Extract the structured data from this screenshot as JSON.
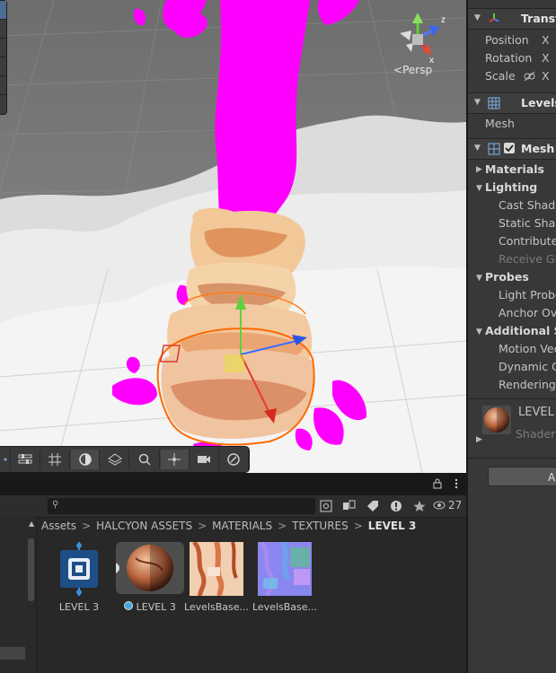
{
  "scene": {
    "camera_label": "Persp",
    "gizmo_axes": {
      "x": "x",
      "z": "z",
      "y": "y"
    }
  },
  "scene_toolbar": {
    "tools": [
      "toolbar-edge",
      "settings-icon",
      "grid-icon",
      "shading-icon",
      "layers-icon",
      "search-icon",
      "move-icon",
      "camera-icon",
      "gizmos-icon"
    ]
  },
  "project": {
    "search": {
      "placeholder": ""
    },
    "visible_count": "27",
    "breadcrumb": [
      "Assets",
      "HALCYON ASSETS",
      "MATERIALS",
      "TEXTURES",
      "LEVEL 3"
    ],
    "assets": [
      {
        "label": "LEVEL 3",
        "kind": "prefab"
      },
      {
        "label": "LEVEL 3",
        "kind": "material"
      },
      {
        "label": "LevelsBase...",
        "kind": "texture-albedo"
      },
      {
        "label": "LevelsBase...",
        "kind": "texture-normal"
      }
    ]
  },
  "inspector": {
    "transform": {
      "title": "Transform",
      "position_label": "Position",
      "rotation_label": "Rotation",
      "scale_label": "Scale",
      "axis_x": "X"
    },
    "mesh_filter": {
      "title": "Levels",
      "mesh_label": "Mesh"
    },
    "mesh_renderer": {
      "title": "Mesh R",
      "materials": "Materials",
      "lighting": "Lighting",
      "cast_shadows": "Cast Shado",
      "static_shadow": "Static Shad",
      "contribute": "Contribute G",
      "receive_gi": "Receive Glo",
      "probes": "Probes",
      "light_probes": "Light Probe",
      "anchor_override": "Anchor Ove",
      "additional": "Additional Set",
      "motion_vectors": "Motion Vecto",
      "dynamic_occlusion": "Dynamic Oc",
      "rendering_layer": "Rendering L"
    },
    "material": {
      "name": "LEVEL",
      "shader_label": "Shader"
    },
    "add_component": "A"
  },
  "colors": {
    "accent_blue": "#4a6d91",
    "magenta": "#ff00ff",
    "selection_orange": "#ff7a1a"
  }
}
